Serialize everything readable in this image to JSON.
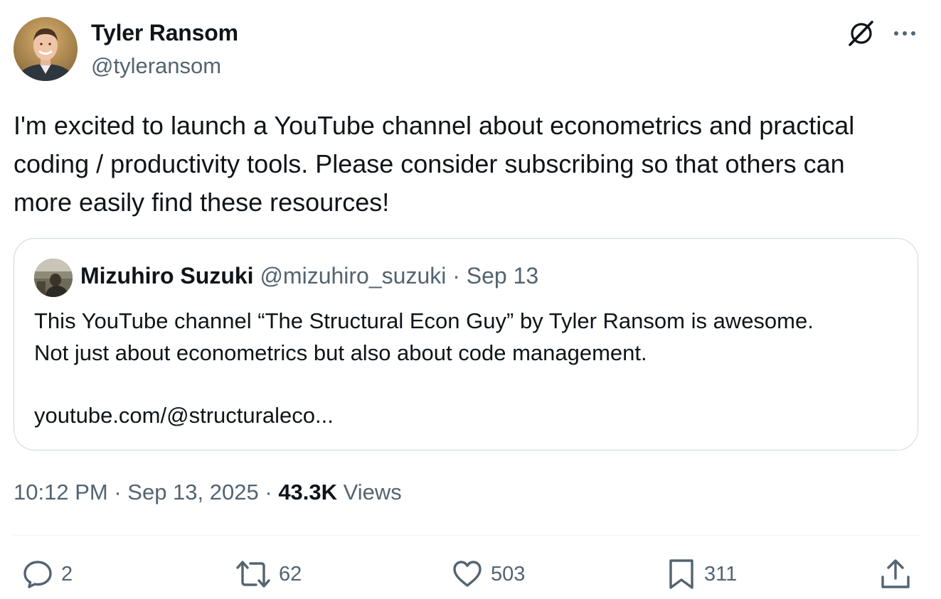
{
  "author": {
    "display_name": "Tyler Ransom",
    "handle": "@tyleransom"
  },
  "icons": {
    "grok": "grok-icon",
    "more": "more-icon",
    "reply": "reply-icon",
    "retweet": "retweet-icon",
    "like": "like-icon",
    "bookmark": "bookmark-icon",
    "share": "share-icon"
  },
  "tweet": {
    "text": "I'm excited to launch a YouTube channel about econometrics and practical\ncoding / productivity tools. Please consider subscribing so that others can\nmore easily find these resources!"
  },
  "quote": {
    "display_name": "Mizuhiro Suzuki",
    "handle": "@mizuhiro_suzuki",
    "separator": "·",
    "date": "Sep 13",
    "text": "This YouTube channel “The Structural Econ Guy” by Tyler Ransom is awesome.\nNot just about econometrics but also about code management.",
    "link": "youtube.com/@structuraleco..."
  },
  "meta": {
    "time": "10:12 PM",
    "separator": "·",
    "date": "Sep 13, 2025",
    "views_count": "43.3K",
    "views_label": "Views"
  },
  "actions": {
    "replies": "2",
    "retweets": "62",
    "likes": "503",
    "bookmarks": "311"
  },
  "colors": {
    "text_primary": "#0f1419",
    "text_secondary": "#536471",
    "border": "#cfd9de",
    "divider": "#eff3f4"
  }
}
